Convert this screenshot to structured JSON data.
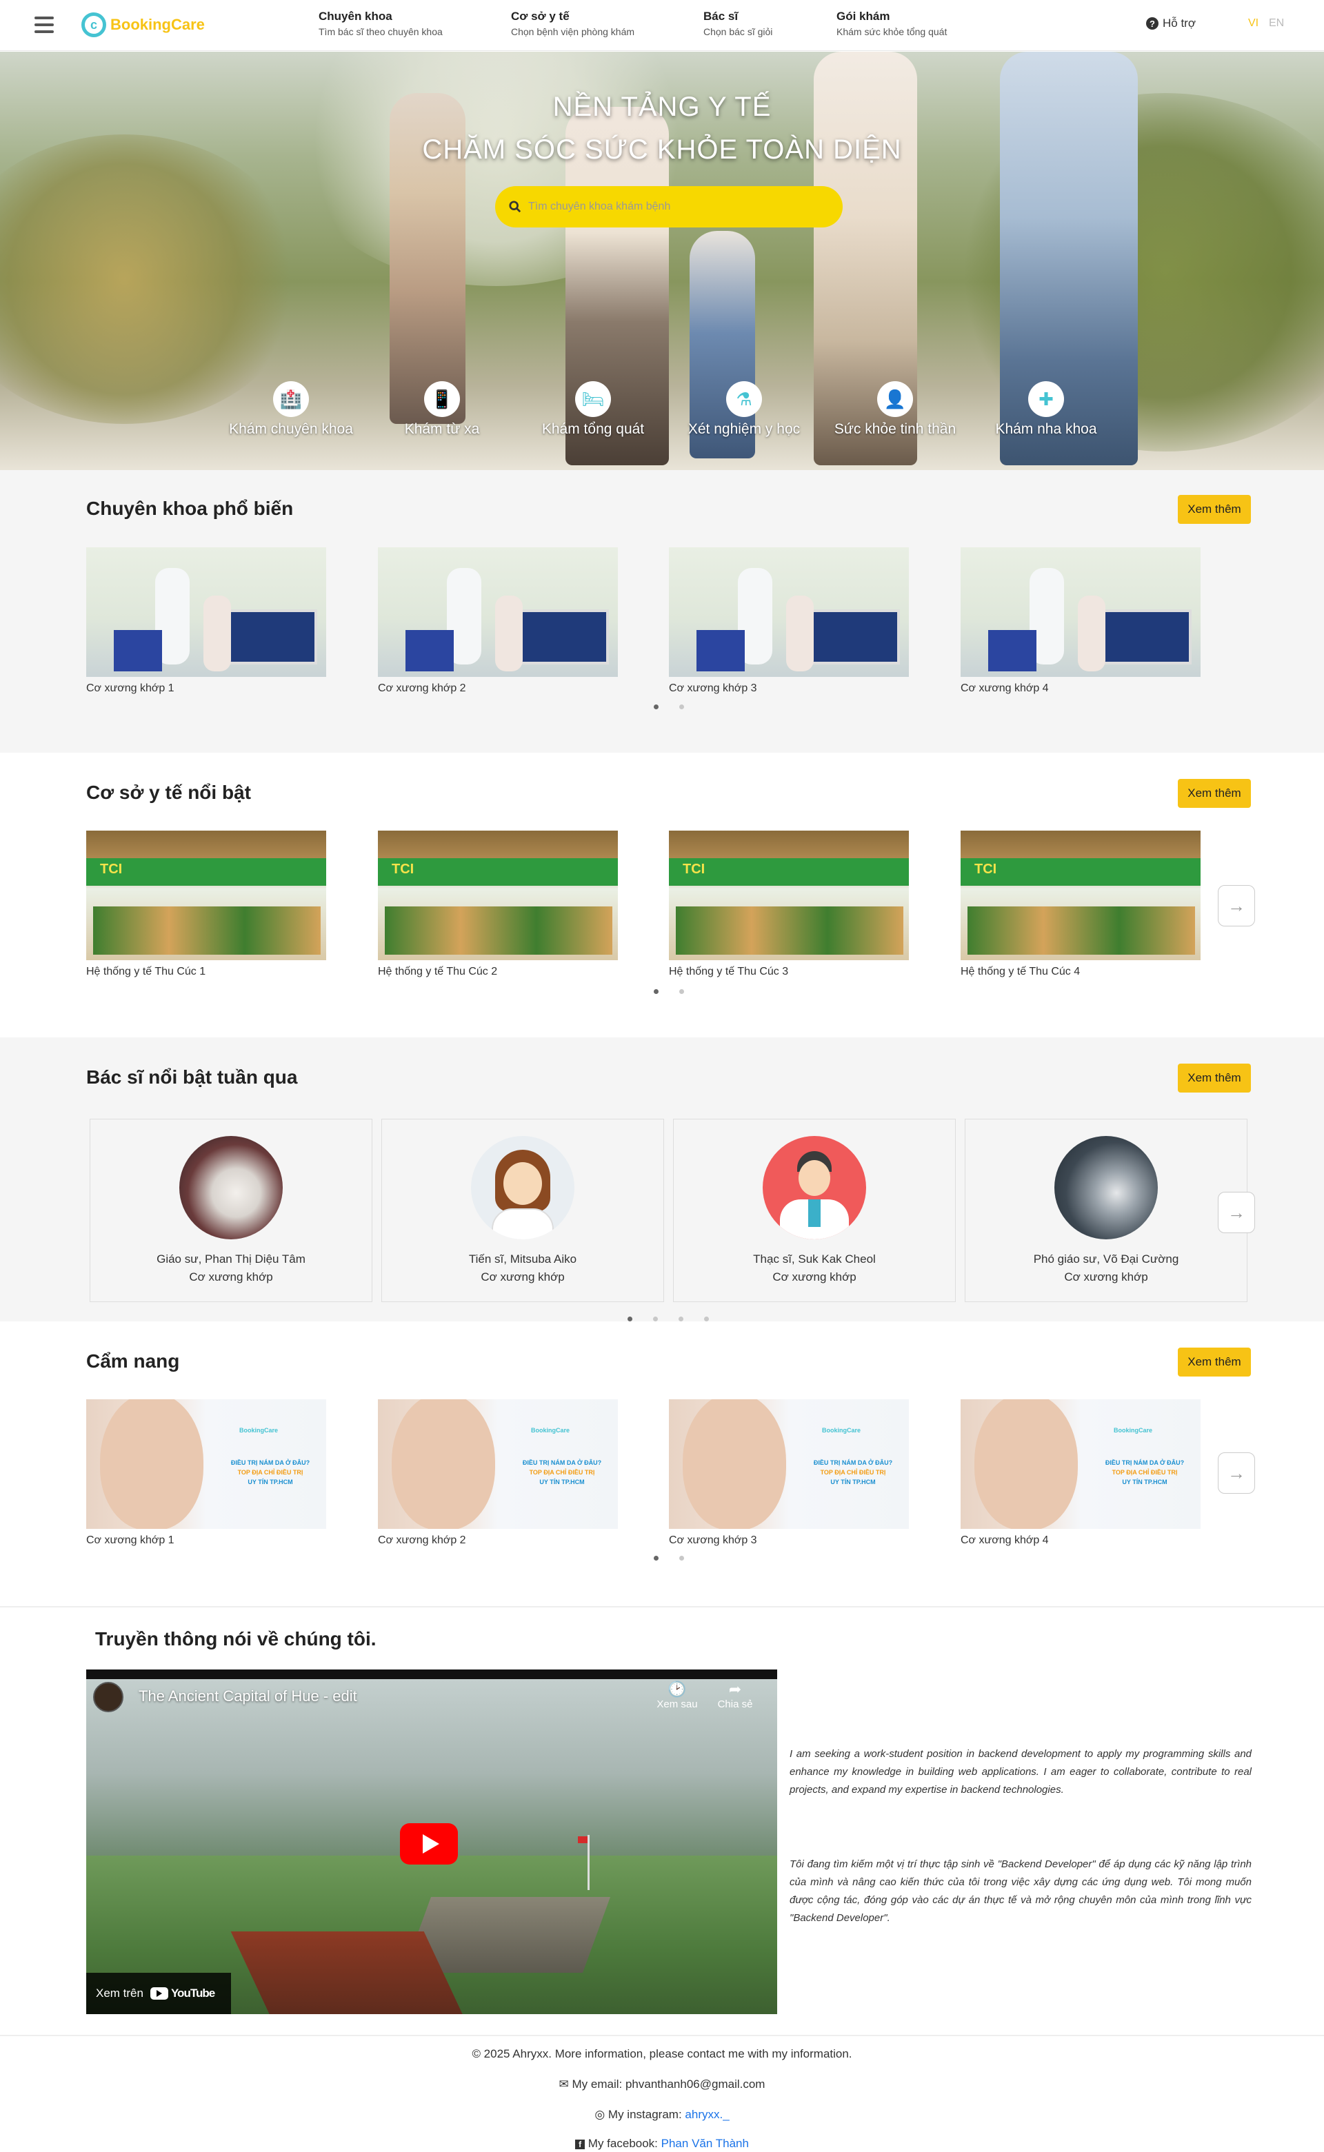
{
  "header": {
    "logo_text": "BookingCare",
    "nav": [
      {
        "title": "Chuyên khoa",
        "sub": "Tìm bác sĩ theo chuyên khoa"
      },
      {
        "title": "Cơ sở y tế",
        "sub": "Chọn bệnh viện phòng khám"
      },
      {
        "title": "Bác sĩ",
        "sub": "Chọn bác sĩ giỏi"
      },
      {
        "title": "Gói khám",
        "sub": "Khám sức khỏe tổng quát"
      }
    ],
    "help_label": "Hỗ trợ",
    "lang_vi": "VI",
    "lang_en": "EN",
    "active_lang_color": "#f7c315"
  },
  "hero": {
    "title1": "NỀN TẢNG Y TẾ",
    "title2": "CHĂM SÓC SỨC KHỎE TOÀN DIỆN",
    "search_placeholder": "Tìm chuyên khoa khám bệnh",
    "options": [
      {
        "label": "Khám chuyên khoa",
        "icon": "hospital-icon"
      },
      {
        "label": "Khám từ xa",
        "icon": "mobile-icon"
      },
      {
        "label": "Khám tổng quát",
        "icon": "bed-icon"
      },
      {
        "label": "Xét nghiệm y học",
        "icon": "flask-icon"
      },
      {
        "label": "Sức khỏe tinh thần",
        "icon": "user-doctor-icon"
      },
      {
        "label": "Khám nha khoa",
        "icon": "briefcase-medical-icon"
      }
    ]
  },
  "specialty": {
    "title": "Chuyên khoa phổ biến",
    "more": "Xem thêm",
    "items": [
      "Cơ xương khớp 1",
      "Cơ xương khớp 2",
      "Cơ xương khớp 3",
      "Cơ xương khớp 4"
    ]
  },
  "facility": {
    "title": "Cơ sở y tế nổi bật",
    "more": "Xem thêm",
    "items": [
      "Hệ thống y tế Thu Cúc 1",
      "Hệ thống y tế Thu Cúc 2",
      "Hệ thống y tế Thu Cúc 3",
      "Hệ thống y tế Thu Cúc 4"
    ],
    "sign_text": "TCI"
  },
  "doctors": {
    "title": "Bác sĩ nổi bật tuần qua",
    "more": "Xem thêm",
    "items": [
      {
        "name": "Giáo sư, Phan Thị Diệu Tâm",
        "specialty": "Cơ xương khớp"
      },
      {
        "name": "Tiến sĩ, Mitsuba Aiko",
        "specialty": "Cơ xương khớp"
      },
      {
        "name": "Thạc sĩ, Suk Kak Cheol",
        "specialty": "Cơ xương khớp"
      },
      {
        "name": "Phó giáo sư, Võ Đại Cường",
        "specialty": "Cơ xương khớp"
      }
    ]
  },
  "handbook": {
    "title": "Cẩm nang",
    "more": "Xem thêm",
    "items": [
      "Cơ xương khớp 1",
      "Cơ xương khớp 2",
      "Cơ xương khớp 3",
      "Cơ xương khớp 4"
    ],
    "thumb_logo": "BookingCare",
    "thumb_line1": "ĐIỀU TRỊ NÁM DA Ở ĐÂU?",
    "thumb_line2": "TOP ĐỊA CHỈ ĐIỀU TRỊ",
    "thumb_line3": "UY TÍN TP.HCM"
  },
  "media": {
    "title": "Truyền thông nói về chúng tôi.",
    "video_title": "The Ancient Capital of Hue - edit",
    "watch_later": "Xem sau",
    "share": "Chia sẻ",
    "watch_on": "Xem trên",
    "youtube": "YouTube",
    "para_en": "I am seeking a work-student position in backend development to apply my programming skills and enhance my knowledge in building web applications. I am eager to collaborate, contribute to real projects, and expand my expertise in backend technologies.",
    "para_vi": "Tôi đang tìm kiếm một vị trí thực tập sinh về \"Backend Developer\" để áp dụng các kỹ năng lập trình của mình và nâng cao kiến thức của tôi trong việc xây dựng các ứng dụng web. Tôi mong muốn được cộng tác, đóng góp vào các dự án thực tế và mở rộng chuyên môn của mình trong lĩnh vực \"Backend Developer\"."
  },
  "footer": {
    "copyright": "© 2025 Ahryxx. More information, please contact me with my information.",
    "email_label": "My email:",
    "email": "phvanthanh06@gmail.com",
    "instagram_label": "My instagram:",
    "instagram": "ahryxx._",
    "facebook_label": "My facebook:",
    "facebook": "Phan Văn Thành"
  }
}
